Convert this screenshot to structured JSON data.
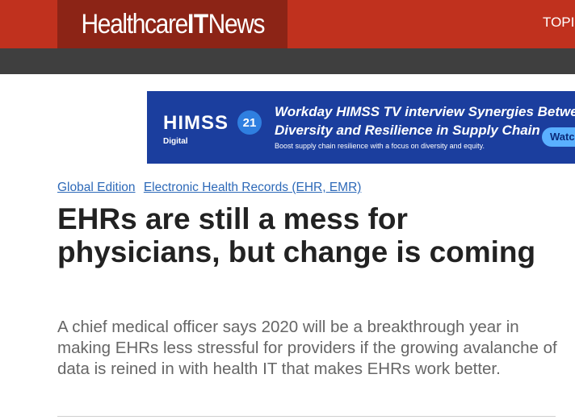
{
  "header": {
    "logo_healthcare": "Healthcare",
    "logo_it": "IT",
    "logo_news": "News",
    "nav_item": "TOPI"
  },
  "ad": {
    "brand": "HIMSS",
    "badge": "21",
    "brand_sub": "Digital",
    "headline_line1": "Workday HIMSS TV interview Synergies Betwe",
    "headline_line2": "Diversity and Resilience in Supply Chain",
    "subline": "Boost supply chain resilience with a focus on diversity and equity.",
    "button": "Watch"
  },
  "article": {
    "categories": [
      "Global Edition",
      "Electronic Health Records (EHR, EMR)"
    ],
    "title": "EHRs are still a mess for physicians, but change is coming",
    "summary": "A chief medical officer says 2020 will be a breakthrough year in making EHRs less stressful for providers if the growing avalanche of data is reined in with health IT that makes EHRs work better."
  },
  "colors": {
    "header_red": "#c0311e",
    "logo_bg": "#8c2416",
    "nav_bar": "#3f3f3f",
    "ad_blue": "#1b3e9e",
    "link_blue": "#2d69b8"
  }
}
